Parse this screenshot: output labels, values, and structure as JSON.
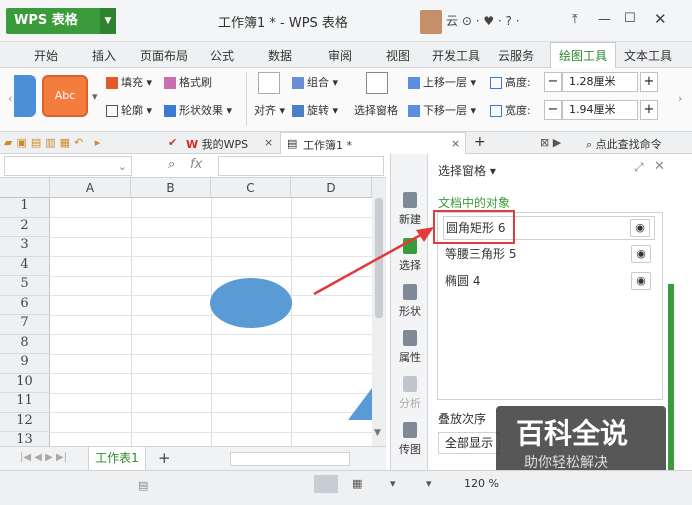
{
  "app": {
    "logo": "WPS 表格",
    "title": "工作簿1 * - WPS 表格",
    "user": "云",
    "controls": "⊙ · ♥ · ? ·"
  },
  "menu": [
    "开始",
    "插入",
    "页面布局",
    "公式",
    "数据",
    "审阅",
    "视图",
    "开发工具",
    "云服务",
    "绘图工具",
    "文本工具"
  ],
  "ribbon": {
    "style_label": "Abc",
    "fill": "填充",
    "format_painter": "格式刷",
    "outline": "轮廓",
    "shape_effects": "形状效果",
    "align": "对齐",
    "group": "组合",
    "rotate": "旋转",
    "selection_pane": "选择窗格",
    "bring_forward": "上移一层",
    "send_backward": "下移一层",
    "height_label": "高度:",
    "height_value": "1.28厘米",
    "width_label": "宽度:",
    "width_value": "1.94厘米",
    "minus": "−",
    "plus": "+"
  },
  "tabs": {
    "mywps": "我的WPS",
    "workbook": "工作簿1 *",
    "search": "点此查找命令",
    "close": "×",
    "add": "+"
  },
  "formula": {
    "fx": "fx"
  },
  "grid": {
    "columns": [
      "A",
      "B",
      "C",
      "D"
    ],
    "rows": [
      "1",
      "2",
      "3",
      "4",
      "5",
      "6",
      "7",
      "8",
      "9",
      "10",
      "11",
      "12",
      "13"
    ]
  },
  "sheet": {
    "tab": "工作表1",
    "add": "+",
    "nav": "|◀ ◀ ▶ ▶|"
  },
  "sidebar": [
    "新建",
    "选择",
    "形状",
    "属性",
    "分析",
    "传图"
  ],
  "panel": {
    "title": "选择窗格 ▾",
    "section": "文档中的对象",
    "objects": [
      "圆角矩形 6",
      "等腰三角形 5",
      "椭圆 4"
    ],
    "order_label": "叠放次序",
    "show_all": "全部显示"
  },
  "watermark": {
    "title": "百科全说",
    "subtitle": "助你轻松解决"
  },
  "status": {
    "zoom": "120 %"
  },
  "colors": {
    "accent": "#3a9b3a",
    "ellipse": "#5b9bd5",
    "arrow": "#e23b3b",
    "highlight": "#e23b3b"
  }
}
